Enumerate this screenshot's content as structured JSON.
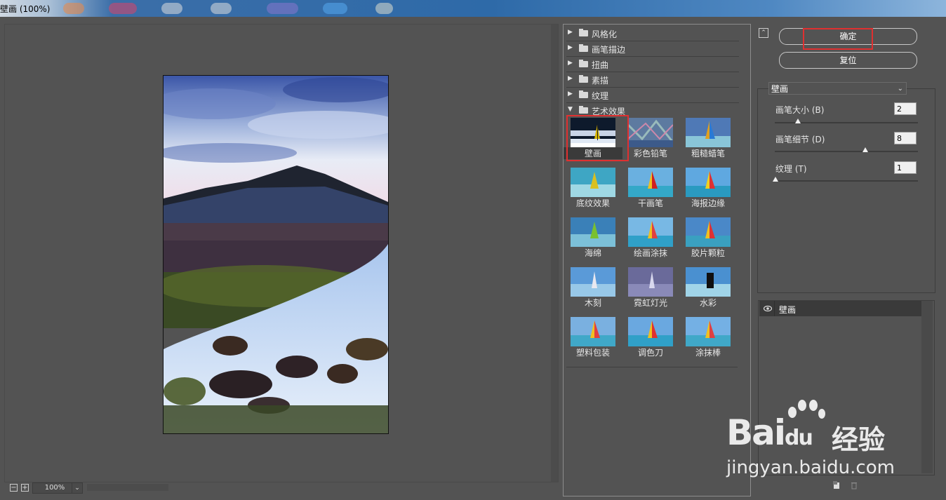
{
  "window": {
    "title": "壁画 (100%)"
  },
  "preview": {
    "zoom": "100%"
  },
  "gallery": {
    "categories": [
      {
        "label": "风格化",
        "expanded": false
      },
      {
        "label": "画笔描边",
        "expanded": false
      },
      {
        "label": "扭曲",
        "expanded": false
      },
      {
        "label": "素描",
        "expanded": false
      },
      {
        "label": "纹理",
        "expanded": false
      },
      {
        "label": "艺术效果",
        "expanded": true
      }
    ],
    "filters": [
      "壁画",
      "彩色铅笔",
      "粗糙蜡笔",
      "底纹效果",
      "干画笔",
      "海报边缘",
      "海绵",
      "绘画涂抹",
      "胶片颗粒",
      "木刻",
      "霓虹灯光",
      "水彩",
      "塑料包装",
      "调色刀",
      "涂抹棒"
    ],
    "selected": "壁画"
  },
  "controls": {
    "ok_label": "确定",
    "reset_label": "复位",
    "filter_select": "壁画",
    "params": [
      {
        "label": "画笔大小 (B)",
        "value": "2",
        "max": 10
      },
      {
        "label": "画笔细节 (D)",
        "value": "8",
        "max": 10
      },
      {
        "label": "纹理 (T)",
        "value": "1",
        "max": 3,
        "min": 1
      }
    ]
  },
  "layers": {
    "items": [
      "壁画"
    ]
  },
  "watermark": {
    "logo": "Bai du 经验",
    "url": "jingyan.baidu.com"
  },
  "colors": {
    "highlight": "#e03030",
    "panel_bg": "#535353",
    "selected_row": "#3a3a3a"
  }
}
